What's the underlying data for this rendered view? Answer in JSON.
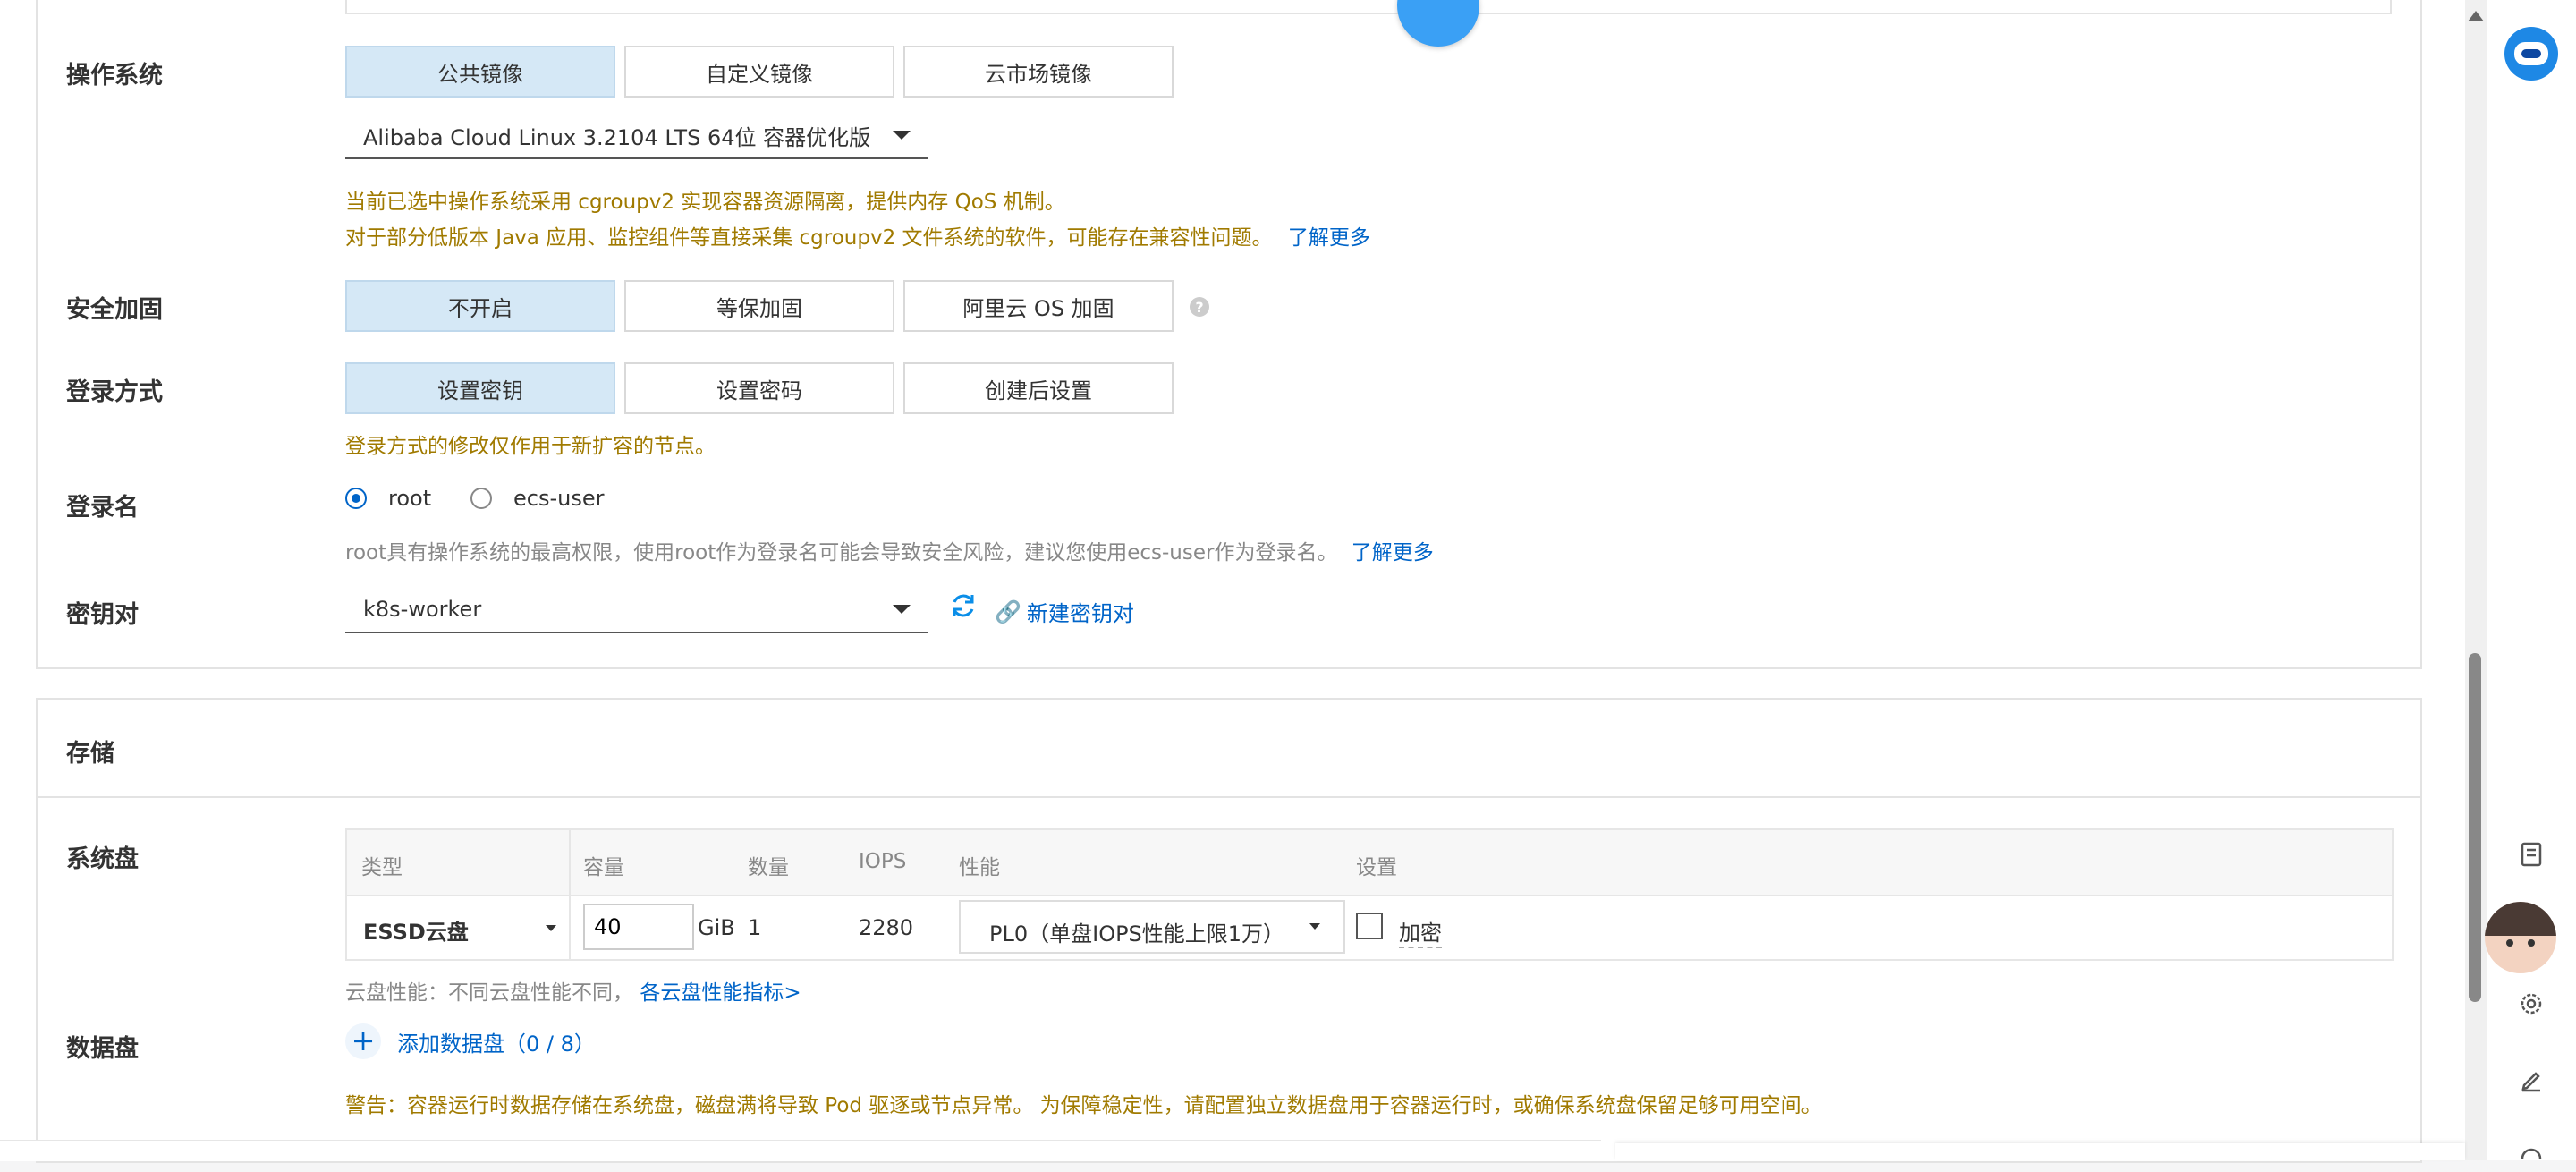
{
  "os": {
    "label": "操作系统",
    "tabs": [
      "公共镜像",
      "自定义镜像",
      "云市场镜像"
    ],
    "selected_image": "Alibaba Cloud Linux 3.2104 LTS 64位 容器优化版",
    "note1": "当前已选中操作系统采用 cgroupv2 实现容器资源隔离，提供内存 QoS 机制。",
    "note2": "对于部分低版本 Java 应用、监控组件等直接采集 cgroupv2 文件系统的软件，可能存在兼容性问题。",
    "learn_more": "了解更多"
  },
  "security": {
    "label": "安全加固",
    "tabs": [
      "不开启",
      "等保加固",
      "阿里云 OS 加固"
    ]
  },
  "login_method": {
    "label": "登录方式",
    "tabs": [
      "设置密钥",
      "设置密码",
      "创建后设置"
    ],
    "note": "登录方式的修改仅作用于新扩容的节点。"
  },
  "login_name": {
    "label": "登录名",
    "option_root": "root",
    "option_ecs": "ecs-user",
    "note": "root具有操作系统的最高权限，使用root作为登录名可能会导致安全风险，建议您使用ecs-user作为登录名。",
    "learn_more": "了解更多"
  },
  "keypair": {
    "label": "密钥对",
    "selected": "k8s-worker",
    "create_link": "新建密钥对"
  },
  "storage": {
    "title": "存储",
    "system_disk_label": "系统盘",
    "headers": [
      "类型",
      "容量",
      "数量",
      "IOPS",
      "性能",
      "设置"
    ],
    "row": {
      "type": "ESSD云盘",
      "capacity": "40",
      "unit": "GiB",
      "count": "1",
      "iops": "2280",
      "performance": "PL0（单盘IOPS性能上限1万）",
      "encrypt": "加密"
    },
    "perf_note": "云盘性能：不同云盘性能不同，",
    "perf_link": "各云盘性能指标>",
    "data_disk_label": "数据盘",
    "add_data_disk": "添加数据盘（0 / 8）",
    "warning": "警告：容器运行时数据存储在系统盘，磁盘满将导致 Pod 驱逐或节点异常。 为保障稳定性，请配置独立数据盘用于容器运行时，或确保系统盘保留足够可用空间。"
  },
  "colors": {
    "accent": "#0064c8",
    "warning": "#a07a00",
    "active_tab": "#d5e8f6"
  }
}
